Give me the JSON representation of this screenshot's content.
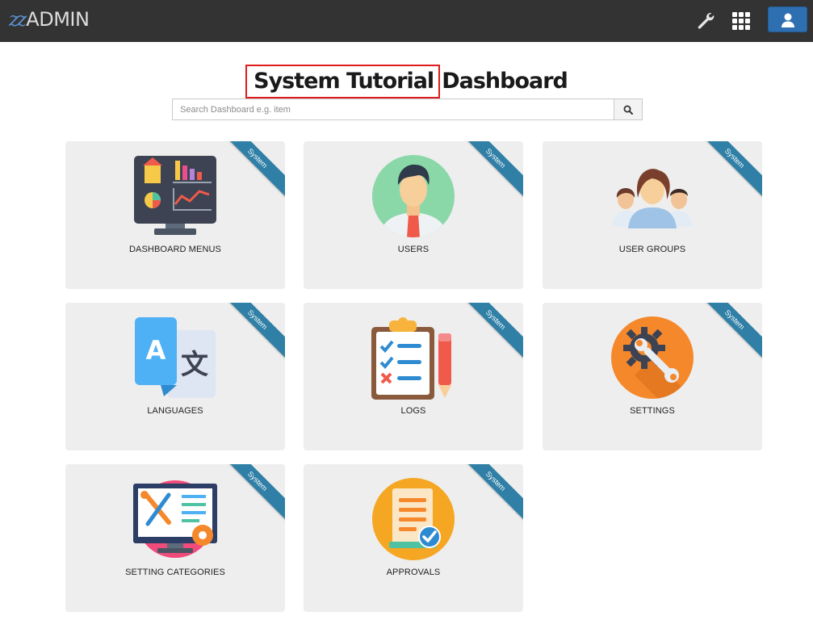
{
  "app": {
    "logo_mark": "zz",
    "logo_text": "ADMIN"
  },
  "header": {
    "icons": [
      "wrench-icon",
      "apps-grid-icon",
      "user-icon"
    ]
  },
  "page": {
    "title_highlight": "System Tutorial",
    "title_rest": "Dashboard",
    "search_placeholder": "Search Dashboard e.g. item"
  },
  "cards": [
    {
      "label": "DASHBOARD MENUS",
      "ribbon": "System",
      "icon": "monitor-dashboard-icon"
    },
    {
      "label": "USERS",
      "ribbon": "System",
      "icon": "user-avatar-icon"
    },
    {
      "label": "USER GROUPS",
      "ribbon": "System",
      "icon": "user-group-icon"
    },
    {
      "label": "LANGUAGES",
      "ribbon": "System",
      "icon": "translate-icon"
    },
    {
      "label": "LOGS",
      "ribbon": "System",
      "icon": "clipboard-checklist-icon"
    },
    {
      "label": "SETTINGS",
      "ribbon": "System",
      "icon": "gear-wrench-icon"
    },
    {
      "label": "SETTING CATEGORIES",
      "ribbon": "System",
      "icon": "monitor-tools-icon"
    },
    {
      "label": "APPROVALS",
      "ribbon": "System",
      "icon": "document-approved-icon"
    }
  ]
}
